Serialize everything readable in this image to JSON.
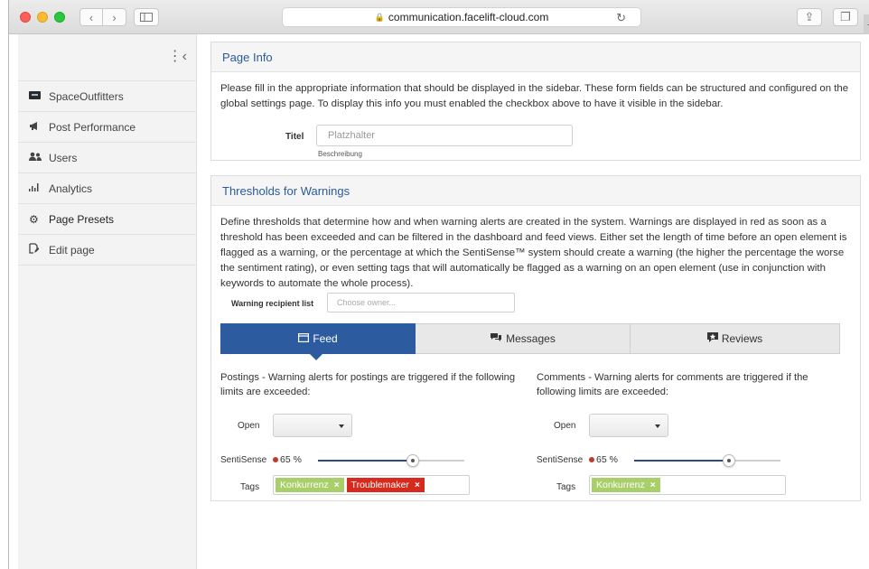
{
  "browser": {
    "url": "communication.facelift-cloud.com",
    "back_glyph": "‹",
    "forward_glyph": "›",
    "reload_glyph": "↻",
    "share_glyph": "⇪",
    "tabs_glyph": "❐",
    "newtab_glyph": "+"
  },
  "sidebar": {
    "collapse_glyph": "⋮‹",
    "items": [
      {
        "label": "SpaceOutfitters",
        "icon": "brand-logo-icon"
      },
      {
        "label": "Post Performance",
        "icon": "megaphone-icon",
        "glyph": "📢"
      },
      {
        "label": "Users",
        "icon": "users-icon",
        "glyph": "👥"
      },
      {
        "label": "Analytics",
        "icon": "bar-chart-icon",
        "glyph": "ılıl"
      },
      {
        "label": "Page Presets",
        "icon": "gear-icon",
        "glyph": "⚙"
      },
      {
        "label": "Edit page",
        "icon": "edit-page-icon",
        "glyph": "📝"
      }
    ]
  },
  "page_info": {
    "title": "Page Info",
    "description": "Please fill in the appropriate information that should be displayed in the sidebar. These form fields can be structured and configured on the global settings page. To display this info you must enabled the checkbox above to have it visible in the sidebar.",
    "titel_label": "Titel",
    "titel_placeholder": "Platzhalter",
    "titel_help": "Beschreibung"
  },
  "thresholds": {
    "title": "Thresholds for Warnings",
    "description": "Define thresholds that determine how and when warning alerts are created in the system. Warnings are displayed in red as soon as a threshold has been exceeded and can be filtered in the dashboard and feed views. Either set the length of time before an open element is flagged as a warning, or the percentage at which the SentiSense™ system should create a warning (the higher the percentage the worse the sentiment rating), or even setting tags that will automatically be flagged as a warning on an open element (use in conjunction with keywords to automate the whole process).",
    "recipient_label": "Warning recipient list",
    "recipient_placeholder": "Choose owner...",
    "tabs": [
      {
        "label": "Feed",
        "icon": "feed-icon",
        "glyph": "▤",
        "active": true
      },
      {
        "label": "Messages",
        "icon": "messages-icon",
        "glyph": "💬",
        "active": false
      },
      {
        "label": "Reviews",
        "icon": "reviews-icon",
        "glyph": "▣",
        "active": false
      }
    ],
    "postings": {
      "description": "Postings - Warning alerts for postings are triggered if the following limits are exceeded:",
      "open_label": "Open",
      "open_value": "",
      "sentisense_label": "SentiSense",
      "sentisense_value": "65 %",
      "sentisense_percent": 65,
      "tags_label": "Tags",
      "tags": [
        {
          "label": "Konkurrenz",
          "color": "#a9cf6b"
        },
        {
          "label": "Troublemaker",
          "color": "#d62a1e"
        }
      ]
    },
    "comments": {
      "description": "Comments - Warning alerts for comments are triggered if the following limits are exceeded:",
      "open_label": "Open",
      "open_value": "",
      "sentisense_label": "SentiSense",
      "sentisense_value": "65 %",
      "sentisense_percent": 65,
      "tags_label": "Tags",
      "tags": [
        {
          "label": "Konkurrenz",
          "color": "#a9cf6b"
        }
      ]
    }
  },
  "colors": {
    "accent": "#2d5ba0",
    "heading": "#2a5a9b",
    "warning_red": "#d62a1e",
    "tag_green": "#a9cf6b"
  }
}
